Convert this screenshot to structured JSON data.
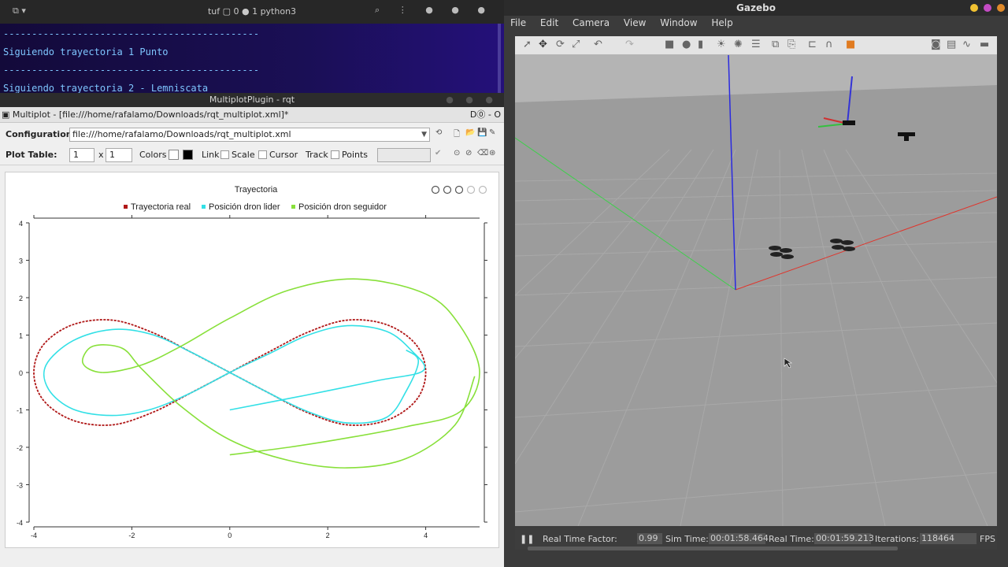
{
  "terminal": {
    "title": "tuf ▢ 0 ● 1 python3",
    "separator": "---------------------------------------------",
    "lines": [
      "Siguiendo trayectoria 1 Punto",
      "Siguiendo trayectoria 2 - Lemniscata"
    ]
  },
  "rqt": {
    "window_title": "MultiplotPlugin - rqt",
    "plugin_label": "Multiplot - [file:///home/rafalamo/Downloads/rqt_multiplot.xml]*",
    "plugin_right": "D⓪  - O",
    "configuration_label": "Configuration:",
    "configuration_value": "file:///home/rafalamo/Downloads/rqt_multiplot.xml",
    "plot_table_label": "Plot Table:",
    "rows": "1",
    "x_sep": "x",
    "cols": "1",
    "colors_label": "Colors",
    "link_label": "Link",
    "scale_label": "Scale",
    "cursor_label": "Cursor",
    "track_label": "Track",
    "points_label": "Points"
  },
  "chart_data": {
    "type": "line",
    "title": "Trayectoria",
    "xlim": [
      -4,
      5.1
    ],
    "ylim": [
      -4,
      4
    ],
    "xticks": [
      -4,
      -2,
      0,
      2,
      4
    ],
    "yticks": [
      4,
      3,
      2,
      1,
      0,
      -1,
      -2,
      -3,
      -4
    ],
    "legend_position": "top",
    "series": [
      {
        "name": "Trayectoria real",
        "color": "#b01818",
        "dashed": true,
        "points": [
          [
            0,
            0
          ],
          [
            0.8,
            0.55
          ],
          [
            1.6,
            1.08
          ],
          [
            2.4,
            1.4
          ],
          [
            3.2,
            1.28
          ],
          [
            3.8,
            0.75
          ],
          [
            4,
            0
          ],
          [
            3.8,
            -0.75
          ],
          [
            3.2,
            -1.28
          ],
          [
            2.4,
            -1.4
          ],
          [
            1.6,
            -1.08
          ],
          [
            0.8,
            -0.55
          ],
          [
            0,
            0
          ],
          [
            -0.8,
            0.55
          ],
          [
            -1.6,
            1.08
          ],
          [
            -2.4,
            1.4
          ],
          [
            -3.2,
            1.28
          ],
          [
            -3.8,
            0.75
          ],
          [
            -4,
            0
          ],
          [
            -3.8,
            -0.75
          ],
          [
            -3.2,
            -1.28
          ],
          [
            -2.4,
            -1.4
          ],
          [
            -1.6,
            -1.08
          ],
          [
            -0.8,
            -0.55
          ],
          [
            0,
            0
          ]
        ]
      },
      {
        "name": "Posición dron lider",
        "color": "#33e0e6",
        "dashed": false,
        "points": [
          [
            0,
            -1
          ],
          [
            1.5,
            -0.62
          ],
          [
            3,
            -0.22
          ],
          [
            3.95,
            0.05
          ],
          [
            3.7,
            0.6
          ],
          [
            3.2,
            1.1
          ],
          [
            2.4,
            1.25
          ],
          [
            1.6,
            1.0
          ],
          [
            0.8,
            0.5
          ],
          [
            0,
            0
          ],
          [
            -0.8,
            -0.55
          ],
          [
            -1.6,
            -0.98
          ],
          [
            -2.4,
            -1.15
          ],
          [
            -3.2,
            -0.98
          ],
          [
            -3.7,
            -0.45
          ],
          [
            -3.75,
            0.2
          ],
          [
            -3.2,
            0.85
          ],
          [
            -2.4,
            1.15
          ],
          [
            -1.6,
            1.02
          ],
          [
            -0.8,
            0.55
          ],
          [
            0,
            0
          ],
          [
            0.8,
            -0.55
          ],
          [
            1.6,
            -1.05
          ],
          [
            2.4,
            -1.35
          ],
          [
            3.2,
            -1.2
          ],
          [
            3.6,
            -0.5
          ],
          [
            3.85,
            0.3
          ],
          [
            3.6,
            0.6
          ]
        ]
      },
      {
        "name": "Posición dron seguidor",
        "color": "#88e03a",
        "dashed": false,
        "points": [
          [
            0,
            -2.2
          ],
          [
            1.2,
            -2.0
          ],
          [
            2.4,
            -1.75
          ],
          [
            3.6,
            -1.45
          ],
          [
            4.7,
            -1.05
          ],
          [
            5.1,
            0.0
          ],
          [
            4.7,
            1.25
          ],
          [
            4.0,
            2.1
          ],
          [
            2.6,
            2.5
          ],
          [
            1.2,
            2.2
          ],
          [
            0,
            1.45
          ],
          [
            -1.0,
            0.7
          ],
          [
            -1.8,
            0.2
          ],
          [
            -2.6,
            0.0
          ],
          [
            -3.0,
            0.25
          ],
          [
            -2.8,
            0.7
          ],
          [
            -2.2,
            0.65
          ],
          [
            -1.8,
            0.1
          ],
          [
            -1.0,
            -0.9
          ],
          [
            0,
            -1.8
          ],
          [
            1.2,
            -2.35
          ],
          [
            2.4,
            -2.55
          ],
          [
            3.6,
            -2.3
          ],
          [
            4.6,
            -1.4
          ],
          [
            5.0,
            -0.1
          ]
        ]
      }
    ]
  },
  "gazebo": {
    "title": "Gazebo",
    "menu": [
      "File",
      "Edit",
      "Camera",
      "View",
      "Window",
      "Help"
    ],
    "status": {
      "rtf_label": "Real Time Factor:",
      "rtf_value": "0.99",
      "sim_label": "Sim Time:",
      "sim_value": "00:01:58.464",
      "real_label": "Real Time:",
      "real_value": "00:01:59.213",
      "iter_label": "Iterations:",
      "iter_value": "118464",
      "fps_label": "FPS"
    },
    "colors": {
      "x_axis": "#e0342b",
      "y_axis": "#3dd04a",
      "z_axis": "#2a2ae0"
    }
  }
}
